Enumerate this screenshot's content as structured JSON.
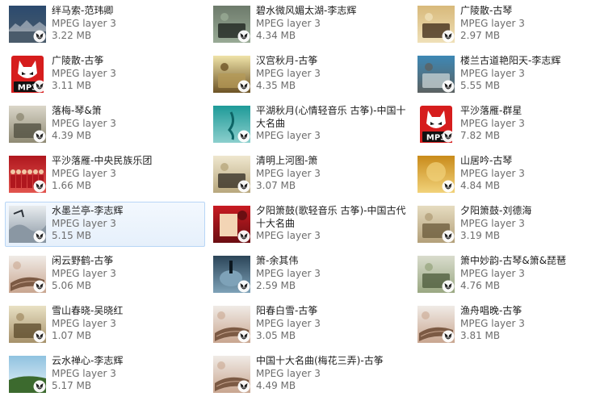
{
  "tiles": [
    {
      "name": "绊马索-范玮卿",
      "type": "MPEG layer 3",
      "size": "3.22 MB",
      "thumb": "photo-skyline-icon",
      "c1": "#2b4a6e",
      "c2": "#c3c9d2",
      "c3": "#4a5b6b"
    },
    {
      "name": "碧水微风媚太湖-李志辉",
      "type": "MPEG layer 3",
      "size": "4.34 MB",
      "thumb": "photo-landscape-icon",
      "c1": "#6d7a6b",
      "c2": "#1a1f1b",
      "c3": "#98aa95"
    },
    {
      "name": "广陵散-古琴",
      "type": "MPEG layer 3",
      "size": "2.97 MB",
      "thumb": "photo-guqin-icon",
      "c1": "#d8b97a",
      "c2": "#3a2614",
      "c3": "#efe0b8"
    },
    {
      "name": "广陵散-古筝",
      "type": "MPEG layer 3",
      "size": "3.11 MB",
      "thumb": "mp3-file-icon",
      "c1": "#d61d1d",
      "c2": "#111111",
      "c3": "#ffffff"
    },
    {
      "name": "汉宫秋月-古筝",
      "type": "MPEG layer 3",
      "size": "4.35 MB",
      "thumb": "photo-guitar-icon",
      "c1": "#efe3a8",
      "c2": "#b59a57",
      "c3": "#6d5325"
    },
    {
      "name": "楼兰古道艳阳天-李志辉",
      "type": "MPEG layer 3",
      "size": "5.55 MB",
      "thumb": "photo-album-icon",
      "c1": "#3d88b5",
      "c2": "#c9d4d6",
      "c3": "#5c6261"
    },
    {
      "name": "落梅-琴&箫",
      "type": "MPEG layer 3",
      "size": "4.39 MB",
      "thumb": "photo-stilllife-icon",
      "c1": "#dad6c9",
      "c2": "#4e4c3e",
      "c3": "#8f8a74"
    },
    {
      "name": "平湖秋月(心情轻音乐 古筝)-中国十大名曲",
      "type": "MPEG layer 3",
      "size": "",
      "thumb": "photo-teal-icon",
      "c1": "#1e9a98",
      "c2": "#0d6566",
      "c3": "#8ccfcd"
    },
    {
      "name": "平沙落雁-群星",
      "type": "MPEG layer 3",
      "size": "7.82 MB",
      "thumb": "mp3-file-icon",
      "c1": "#d61d1d",
      "c2": "#111111",
      "c3": "#ffffff"
    },
    {
      "name": "平沙落雁-中央民族乐团",
      "type": "MPEG layer 3",
      "size": "1.66 MB",
      "thumb": "photo-orchestra-icon",
      "c1": "#b0171e",
      "c2": "#2a0b0b",
      "c3": "#e2544e"
    },
    {
      "name": "清明上河图-箫",
      "type": "MPEG layer 3",
      "size": "3.07 MB",
      "thumb": "photo-xiao-icon",
      "c1": "#efe7cf",
      "c2": "#2f2a22",
      "c3": "#b8a77d"
    },
    {
      "name": "山居吟-古琴",
      "type": "MPEG layer 3",
      "size": "4.84 MB",
      "thumb": "photo-gold-icon",
      "c1": "#c98b1b",
      "c2": "#5a2f08",
      "c3": "#f1d27a"
    },
    {
      "name": "水墨兰亭-李志辉",
      "type": "MPEG layer 3",
      "size": "5.15 MB",
      "thumb": "photo-ink-icon",
      "c1": "#e8ecef",
      "c2": "#2b3138",
      "c3": "#8a97a3"
    },
    {
      "name": "夕阳箫鼓(歌轻音乐 古筝)-中国古代十大名曲",
      "type": "MPEG layer 3",
      "size": "",
      "thumb": "photo-red-icon",
      "c1": "#c81b22",
      "c2": "#f3d5b5",
      "c3": "#6b0e12"
    },
    {
      "name": "夕阳箫鼓-刘德海",
      "type": "MPEG layer 3",
      "size": "3.19 MB",
      "thumb": "photo-beige-icon",
      "c1": "#e6dcc0",
      "c2": "#6a5a3a",
      "c3": "#b3a07a"
    },
    {
      "name": "闲云野鹤-古筝",
      "type": "MPEG layer 3",
      "size": "5.06 MB",
      "thumb": "photo-guzheng-icon",
      "c1": "#f0ebe6",
      "c2": "#7c5a44",
      "c3": "#c9a690"
    },
    {
      "name": "箫-余其伟",
      "type": "MPEG layer 3",
      "size": "2.59 MB",
      "thumb": "photo-pipa-icon",
      "c1": "#2b4558",
      "c2": "#0c1820",
      "c3": "#7ea2b8"
    },
    {
      "name": "箫中妙韵-古琴&箫&琵琶",
      "type": "MPEG layer 3",
      "size": "4.76 MB",
      "thumb": "photo-player-icon",
      "c1": "#d9dccd",
      "c2": "#4b5a3a",
      "c3": "#9aa882"
    },
    {
      "name": "雪山春晓-吴晓红",
      "type": "MPEG layer 3",
      "size": "1.07 MB",
      "thumb": "photo-room-icon",
      "c1": "#e9e1c4",
      "c2": "#5b4a2a",
      "c3": "#a6916a"
    },
    {
      "name": "阳春白雪-古筝",
      "type": "MPEG layer 3",
      "size": "3.05 MB",
      "thumb": "photo-guzheng-icon",
      "c1": "#f0ebe6",
      "c2": "#7c5a44",
      "c3": "#c9a690"
    },
    {
      "name": "渔舟唱晚-古筝",
      "type": "MPEG layer 3",
      "size": "3.81 MB",
      "thumb": "photo-guzheng-icon",
      "c1": "#f0ebe6",
      "c2": "#7c5a44",
      "c3": "#c9a690"
    },
    {
      "name": "云水禅心-李志辉",
      "type": "MPEG layer 3",
      "size": "5.17 MB",
      "thumb": "photo-coast-icon",
      "c1": "#8fc2e0",
      "c2": "#3c6a2e",
      "c3": "#e8f2f8"
    },
    {
      "name": "中国十大名曲(梅花三弄)-古筝",
      "type": "MPEG layer 3",
      "size": "4.49 MB",
      "thumb": "photo-guzheng-icon",
      "c1": "#f0ebe6",
      "c2": "#7c5a44",
      "c3": "#c9a690"
    }
  ],
  "selected_index": 12,
  "play_overlay_icon": "play-overlay-icon"
}
